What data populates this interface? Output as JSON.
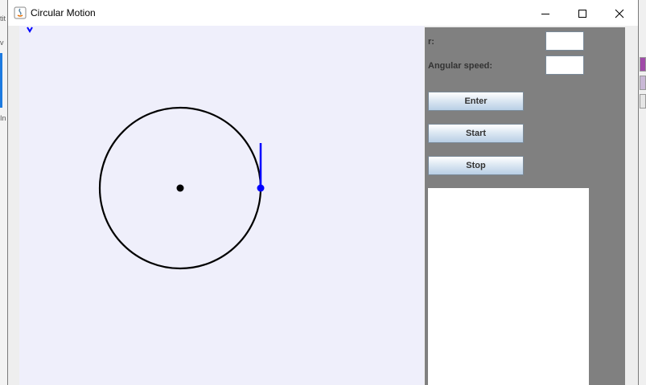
{
  "window": {
    "title": "Circular Motion",
    "minimize_icon": "minimize-icon",
    "maximize_icon": "maximize-icon",
    "close_icon": "close-icon",
    "app_icon": "java-icon"
  },
  "background": {
    "fragments": [
      "tit",
      "v",
      "In"
    ]
  },
  "controls": {
    "r_label": "r:",
    "r_value": "",
    "angular_speed_label": "Angular speed:",
    "angular_speed_value": "",
    "enter_label": "Enter",
    "start_label": "Start",
    "stop_label": "Stop",
    "output_text": ""
  },
  "colors": {
    "canvas_bg": "#efeffb",
    "panel_bg": "#808080",
    "circle": "#000000",
    "moving_point": "#0000ff"
  }
}
